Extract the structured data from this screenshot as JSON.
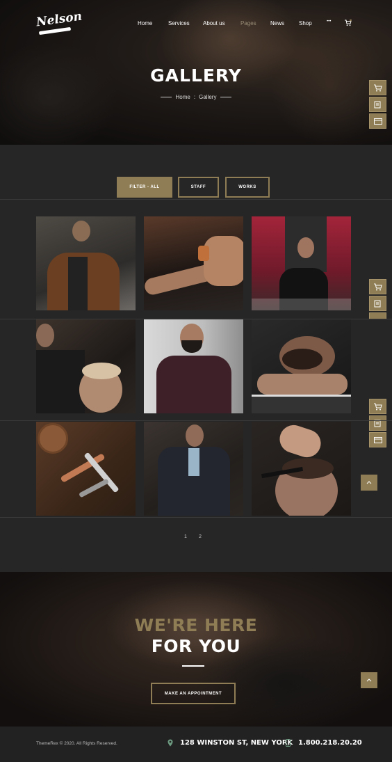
{
  "brand": {
    "logo_text": "Nelson"
  },
  "nav": {
    "items": [
      "Home",
      "Services",
      "About us",
      "Pages",
      "News",
      "Shop"
    ],
    "more": "•••"
  },
  "hero": {
    "title": "GALLERY",
    "breadcrumb": {
      "home": "Home",
      "separator": ":",
      "current": "Gallery"
    }
  },
  "filters": [
    "FILTER - ALL",
    "STAFF",
    "WORKS"
  ],
  "gallery": {
    "items": [
      {
        "icon": "photo-man-brown-jacket"
      },
      {
        "icon": "photo-hands-oil-bottle"
      },
      {
        "icon": "photo-man-red-flowers"
      },
      {
        "icon": "photo-barber-haircut"
      },
      {
        "icon": "photo-man-glasses-beard"
      },
      {
        "icon": "photo-beard-shave"
      },
      {
        "icon": "photo-barber-tools"
      },
      {
        "icon": "photo-man-suit"
      },
      {
        "icon": "photo-comb-haircut"
      }
    ]
  },
  "pagination": [
    "1",
    "2"
  ],
  "cta": {
    "line1": "WE'RE HERE",
    "line2": "FOR YOU",
    "button": "MAKE AN APPOINTMENT"
  },
  "footer": {
    "copyright": "ThemeRex © 2020. All Rights Reserved.",
    "address": "128 WINSTON ST, NEW YORK",
    "phone": "1.800.218.20.20"
  },
  "colors": {
    "accent": "#8f7d55",
    "background": "#262626",
    "footer": "#222222"
  }
}
